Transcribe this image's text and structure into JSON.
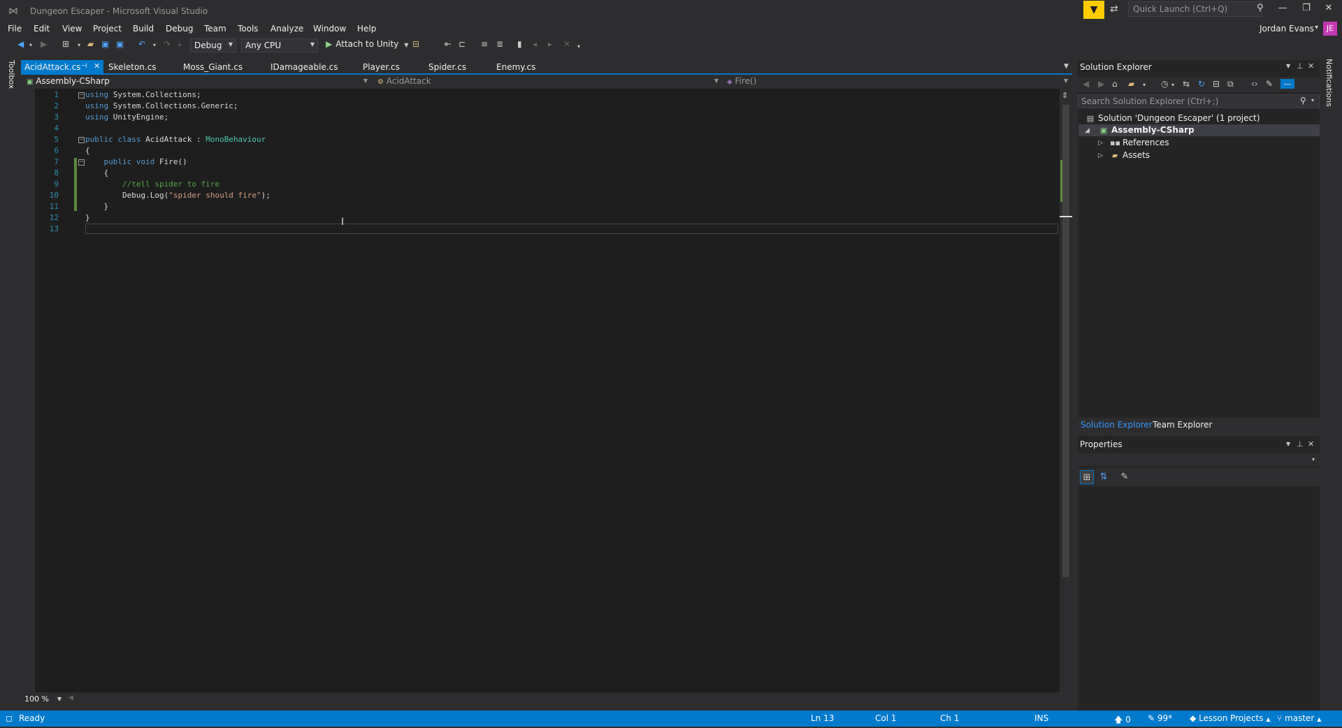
{
  "window": {
    "title": "Dungeon Escaper - Microsoft Visual Studio",
    "quick_launch_placeholder": "Quick Launch (Ctrl+Q)",
    "user_name": "Jordan Evans",
    "user_initials": "JE"
  },
  "menu": [
    "File",
    "Edit",
    "View",
    "Project",
    "Build",
    "Debug",
    "Team",
    "Tools",
    "Analyze",
    "Window",
    "Help"
  ],
  "toolbar": {
    "configuration": "Debug",
    "platform": "Any CPU",
    "attach_label": "Attach to Unity"
  },
  "toolbox_label": "Toolbox",
  "notifications_label": "Notifications",
  "tabs": [
    {
      "label": "AcidAttack.cs",
      "active": true
    },
    {
      "label": "Skeleton.cs"
    },
    {
      "label": "Moss_Giant.cs"
    },
    {
      "label": "IDamageable.cs"
    },
    {
      "label": "Player.cs"
    },
    {
      "label": "Spider.cs"
    },
    {
      "label": "Enemy.cs"
    }
  ],
  "navbar": {
    "project": "Assembly-CSharp",
    "type": "AcidAttack",
    "member": "Fire()"
  },
  "code": {
    "line_numbers": [
      "1",
      "2",
      "3",
      "4",
      "5",
      "6",
      "7",
      "8",
      "9",
      "10",
      "11",
      "12",
      "13"
    ],
    "l1_kw": "using",
    "l1_rest": " System.Collections;",
    "l2_kw": "using",
    "l2_rest": " System.Collections.Generic;",
    "l3_kw": "using",
    "l3_rest": " UnityEngine;",
    "l5_kw": "public class",
    "l5_name": " AcidAttack : ",
    "l5_type": "MonoBehaviour",
    "l6": "{",
    "l7_kw": "    public void",
    "l7_rest": " Fire()",
    "l8": "    {",
    "l9_comment": "        //tell spider to fire",
    "l10_pre": "        Debug.Log(",
    "l10_str": "\"spider should fire\"",
    "l10_post": ");",
    "l11": "    }",
    "l12": "}"
  },
  "zoom": "100 %",
  "solution_explorer": {
    "title": "Solution Explorer",
    "search_placeholder": "Search Solution Explorer (Ctrl+;)",
    "solution": "Solution 'Dungeon Escaper' (1 project)",
    "project": "Assembly-CSharp",
    "references": "References",
    "assets": "Assets",
    "tab_active": "Solution Explorer",
    "tab_other": "Team Explorer"
  },
  "properties": {
    "title": "Properties"
  },
  "status": {
    "ready": "Ready",
    "line": "Ln 13",
    "col": "Col 1",
    "ch": "Ch 1",
    "mode": "INS",
    "pushes": "0",
    "edits": "99*",
    "repo": "Lesson Projects",
    "branch": "master"
  },
  "colors": {
    "accent": "#007acc",
    "background": "#1e1e1e",
    "chrome": "#2d2d30",
    "keyword": "#569cd6",
    "type": "#4ec9b0",
    "comment": "#57a64a",
    "string": "#d69d85",
    "filter_yellow": "#ffcc00",
    "avatar": "#c239b3"
  }
}
